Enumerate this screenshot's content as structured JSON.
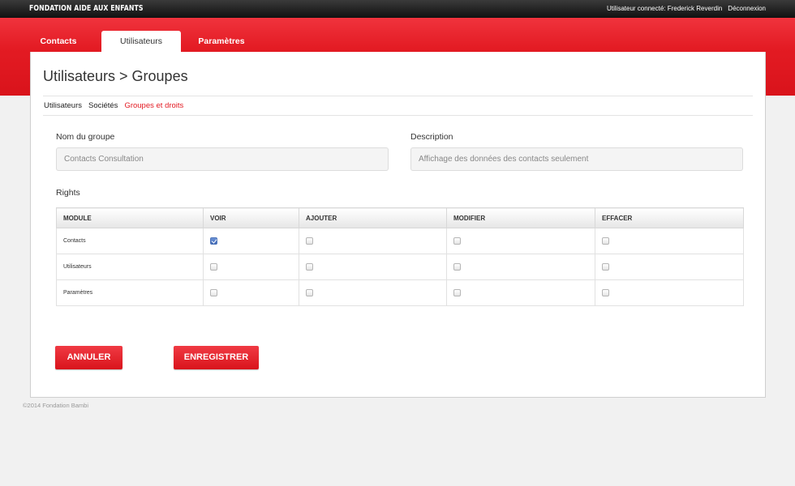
{
  "header": {
    "brand": "FONDATION AIDE AUX ENFANTS",
    "user_label": "Utilisateur connecté: Frederick Reverdin",
    "logout_label": "Déconnexion"
  },
  "tabs": [
    {
      "label": "Contacts",
      "active": false
    },
    {
      "label": "Utilisateurs",
      "active": true
    },
    {
      "label": "Paramètres",
      "active": false
    }
  ],
  "page": {
    "title": "Utilisateurs > Groupes",
    "subnav": [
      {
        "label": "Utilisateurs",
        "active": false
      },
      {
        "label": "Sociétés",
        "active": false
      },
      {
        "label": "Groupes et droits",
        "active": true
      }
    ]
  },
  "form": {
    "group_name_label": "Nom du groupe",
    "group_name_value": "Contacts Consultation",
    "description_label": "Description",
    "description_value": "Affichage des données des contacts seulement"
  },
  "rights": {
    "label": "Rights",
    "columns": [
      "MODULE",
      "VOIR",
      "AJOUTER",
      "MODIFIER",
      "EFFACER"
    ],
    "rows": [
      {
        "module": "Contacts",
        "voir": true,
        "ajouter": false,
        "modifier": false,
        "effacer": false
      },
      {
        "module": "Utilisateurs",
        "voir": false,
        "ajouter": false,
        "modifier": false,
        "effacer": false
      },
      {
        "module": "Paramètres",
        "voir": false,
        "ajouter": false,
        "modifier": false,
        "effacer": false
      }
    ]
  },
  "actions": {
    "cancel_label": "ANNULER",
    "save_label": "ENREGISTRER"
  },
  "footer": {
    "text": "©2014 Fondation Bambi"
  },
  "colors": {
    "brand_red": "#e31b23",
    "topbar": "#1a1a1a",
    "background_grey": "#f1f1f1",
    "checkbox_blue": "#3e67b5"
  }
}
